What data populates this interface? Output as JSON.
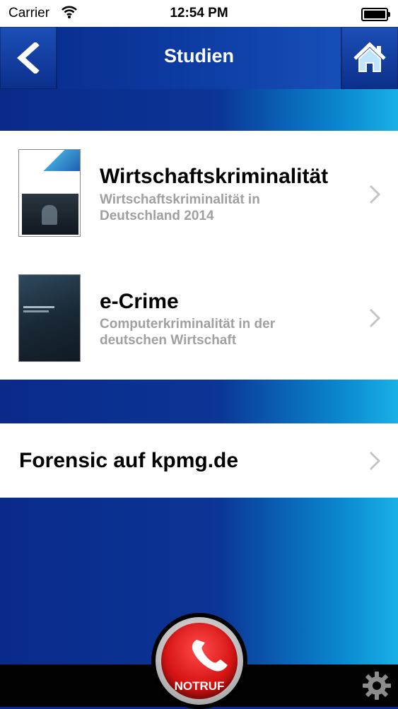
{
  "status_bar": {
    "carrier": "Carrier",
    "time": "12:54 PM"
  },
  "nav": {
    "title": "Studien"
  },
  "studies": [
    {
      "title": "Wirtschaftskriminalität",
      "subtitle": "Wirtschaftskriminalität in Deutschland 2014"
    },
    {
      "title": "e-Crime",
      "subtitle": "Computerkriminalität in der deutschen Wirtschaft"
    }
  ],
  "links": {
    "forensic_label": "Forensic auf kpmg.de"
  },
  "tabbar": {
    "emergency_label": "NOTRUF"
  },
  "colors": {
    "nav_blue": "#0a2a8c",
    "accent_cyan": "#19b0e6",
    "emergency_red": "#d71515",
    "subtitle_gray": "#a0a0a0"
  },
  "icons": [
    "wifi-icon",
    "battery-icon",
    "back-arrow-icon",
    "home-icon",
    "chevron-right-icon",
    "phone-icon",
    "gear-icon"
  ]
}
